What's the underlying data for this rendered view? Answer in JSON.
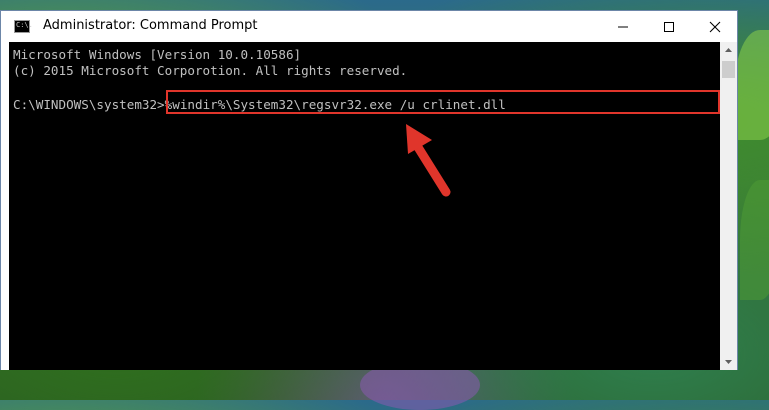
{
  "window": {
    "title": "Administrator: Command Prompt",
    "icon_label": "C:\\."
  },
  "controls": {
    "minimize_icon": "minimize-icon",
    "maximize_icon": "maximize-icon",
    "close_icon": "close-icon"
  },
  "console": {
    "lines": [
      "Microsoft Windows [Version 10.0.10586]",
      "(c) 2015 Microsoft Corporotion. All rights reserved."
    ],
    "prompt": "C:\\WINDOWS\\system32>",
    "command": "%windir%\\System32\\regsvr32.exe /u crlinet.dll"
  },
  "colors": {
    "highlight": "#e0352b",
    "arrow": "#e0352b",
    "console_bg": "#000000",
    "console_text": "#c0c0c0"
  }
}
